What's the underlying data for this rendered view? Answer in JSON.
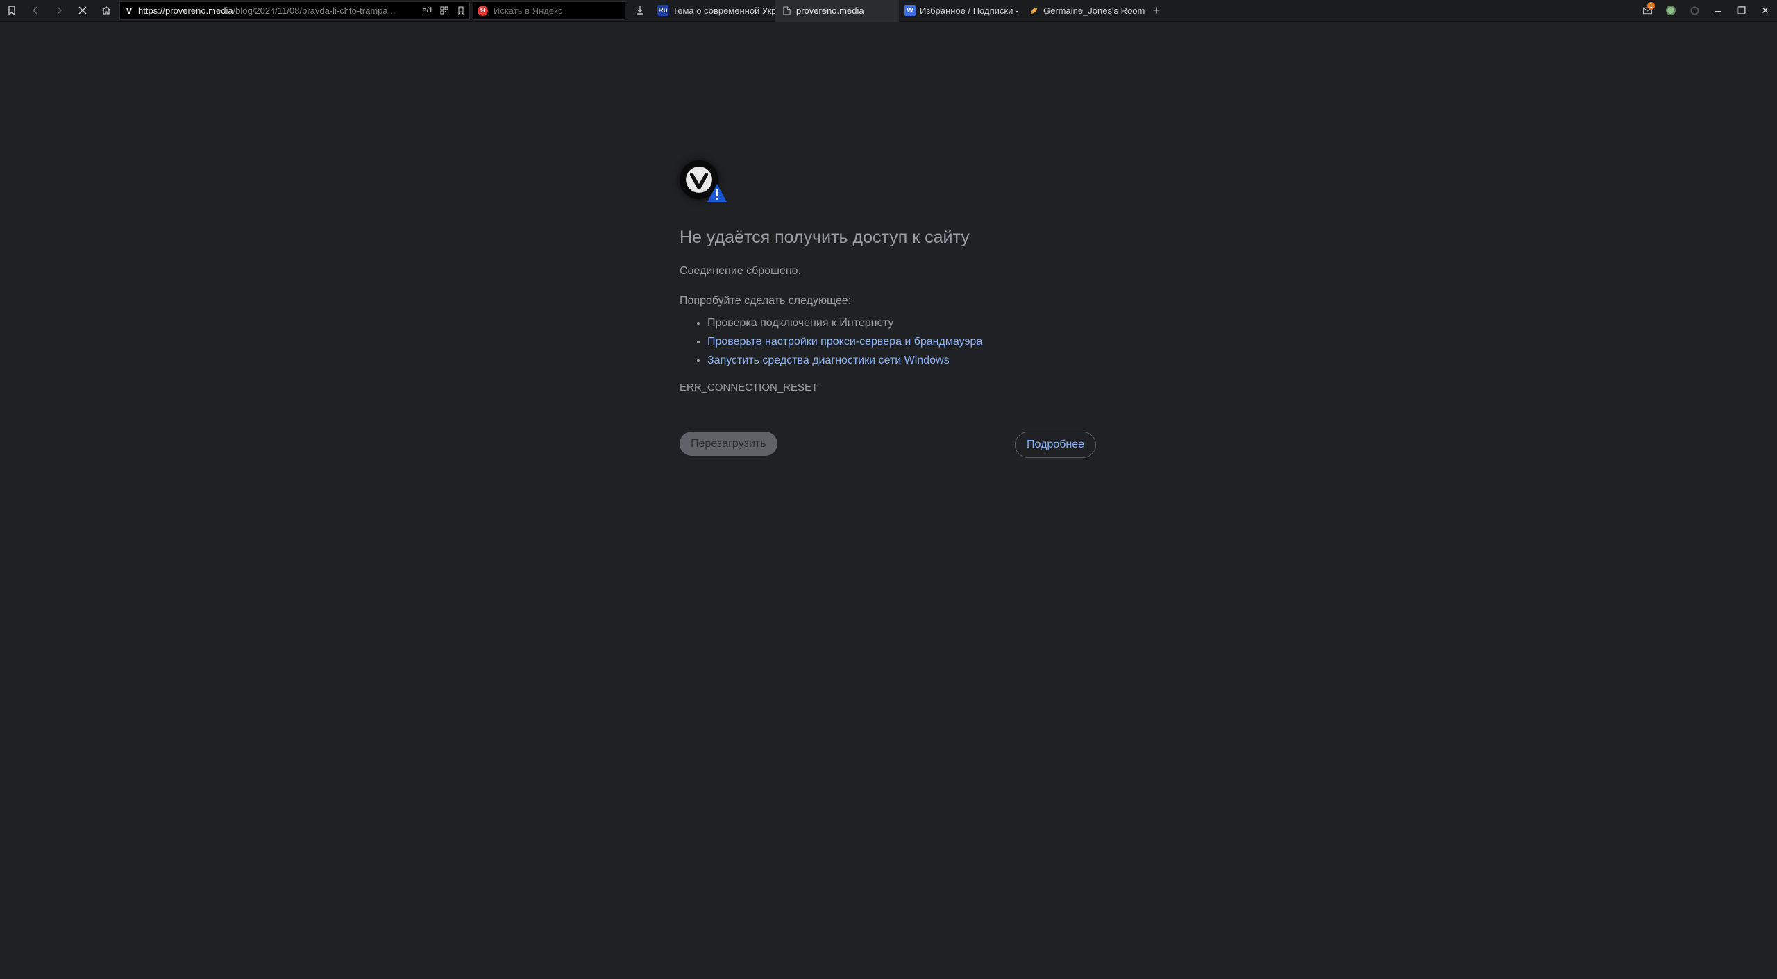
{
  "browser": {
    "address_bar": {
      "url_host": "https://provereno.media",
      "url_path": "/blog/2024/11/08/pravda-li-chto-trampa...",
      "reader_badge": "e/1"
    },
    "search": {
      "placeholder": "Искать в Яндекс",
      "engine_letter": "Я"
    },
    "tabs": [
      {
        "label": "Тема о современной Укр",
        "favicon": "Ru"
      },
      {
        "label": "provereno.media",
        "favicon": "doc-icon",
        "active": true
      },
      {
        "label": "Избранное / Подписки -",
        "favicon": "W"
      },
      {
        "label": "Germaine_Jones's Room @",
        "favicon": "leaf-icon"
      }
    ],
    "mail_badge": "1"
  },
  "error_page": {
    "title": "Не удаётся получить доступ к сайту",
    "subtitle": "Соединение сброшено.",
    "suggest_heading": "Попробуйте сделать следующее:",
    "suggestions": [
      "Проверка подключения к Интернету",
      "Проверьте настройки прокси-сервера и брандмауэра",
      "Запустить средства диагностики сети Windows"
    ],
    "error_code": "ERR_CONNECTION_RESET",
    "reload_label": "Перезагрузить",
    "details_label": "Подробнее"
  },
  "colors": {
    "page_bg": "#202124",
    "text": "#9aa0a6",
    "link": "#8ab4f8",
    "toolbar_bg": "#1b1c1e"
  }
}
